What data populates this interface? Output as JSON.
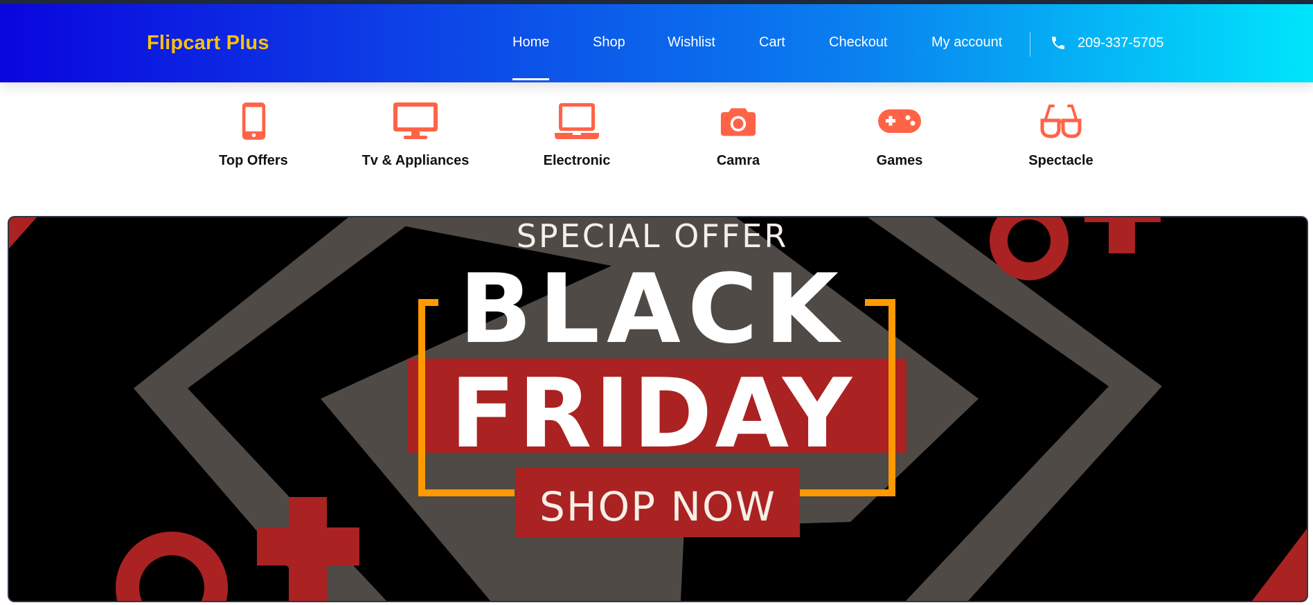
{
  "header": {
    "brand": "Flipcart Plus",
    "nav": [
      {
        "label": "Home",
        "active": true
      },
      {
        "label": "Shop"
      },
      {
        "label": "Wishlist"
      },
      {
        "label": "Cart"
      },
      {
        "label": "Checkout"
      },
      {
        "label": "My account"
      }
    ],
    "phone": "209-337-5705",
    "colors": {
      "brand": "#f9c10c",
      "gradient_start": "#0a05de",
      "gradient_end": "#00e5fb"
    }
  },
  "categories": [
    {
      "label": "Top Offers",
      "icon": "mobile-phone-icon"
    },
    {
      "label": "Tv & Appliances",
      "icon": "monitor-icon"
    },
    {
      "label": "Electronic",
      "icon": "laptop-icon"
    },
    {
      "label": "Camra",
      "icon": "camera-icon"
    },
    {
      "label": "Games",
      "icon": "gamepad-icon"
    },
    {
      "label": "Spectacle",
      "icon": "glasses-icon"
    }
  ],
  "category_icon_color": "#ff6347",
  "banner": {
    "overline": "SPECIAL OFFER",
    "line1": "BLACK",
    "line2": "FRIDAY",
    "cta": "SHOP NOW",
    "colors": {
      "accent_red": "#aa2222",
      "bracket_orange": "#ff9900",
      "shape_gray": "#4f4a45"
    }
  }
}
